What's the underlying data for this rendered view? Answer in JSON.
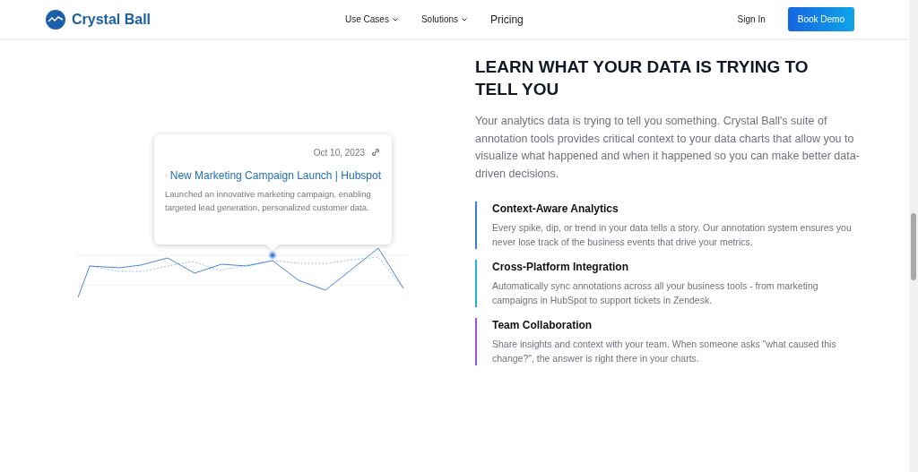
{
  "header": {
    "logo": "Crystal Ball",
    "nav": [
      {
        "label": "Use Cases",
        "dropdown": true
      },
      {
        "label": "Solutions",
        "dropdown": true
      },
      {
        "label": "Pricing",
        "dropdown": false
      }
    ],
    "sign_in": "Sign In",
    "cta": "Book Demo"
  },
  "annotation": {
    "date": "Oct 10, 2023",
    "title": "New Marketing Campaign Launch | Hubspot",
    "text": "Launched an innovative marketing campaign, enabling targeted lead generation, personalized customer data."
  },
  "heading": "LEARN WHAT YOUR DATA IS TRYING TO TELL YOU",
  "intro": "Your analytics data is trying to tell you something. Crystal Ball's suite of annotation tools provides critical context to your data charts that allow you to visualize what happened and when it happened so you can make better data-driven decisions.",
  "features": [
    {
      "title": "Context-Aware Analytics",
      "text": "Every spike, dip, or trend in your data tells a story. Our annotation system ensures you never lose track of the business events that drive your metrics.",
      "color": "#3b7fd9"
    },
    {
      "title": "Cross-Platform Integration",
      "text": "Automatically sync annotations across all your business tools - from marketing campaigns in HubSpot to support tickets in Zendesk.",
      "color": "#1fb5c9"
    },
    {
      "title": "Team Collaboration",
      "text": "Share insights and context with your team. When someone asks \"what caused this change?\", the answer is right there in your charts.",
      "color": "#9b51e0"
    }
  ]
}
